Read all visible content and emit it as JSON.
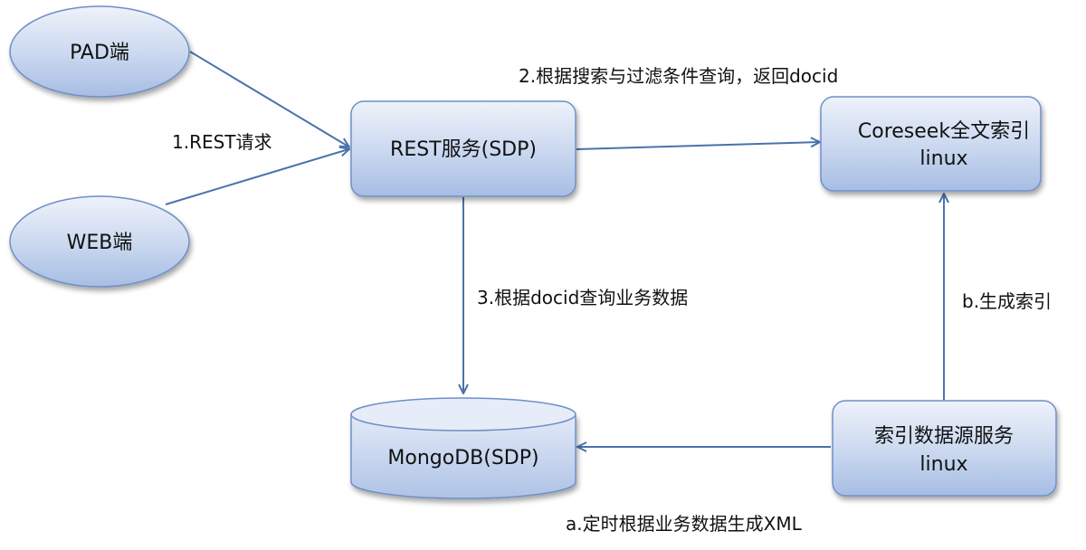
{
  "nodes": {
    "pad": {
      "label": "PAD端"
    },
    "web": {
      "label": "WEB端"
    },
    "rest": {
      "label": "REST服务(SDP)"
    },
    "coreseek": {
      "line1": "Coreseek全文索引",
      "line2": "linux"
    },
    "mongodb": {
      "label": "MongoDB(SDP)"
    },
    "index_source": {
      "line1": "索引数据源服务",
      "line2": "linux"
    }
  },
  "edges": {
    "rest_request": "1.REST请求",
    "query_docid": "2.根据搜索与过滤条件查询，返回docid",
    "query_business": "3.根据docid查询业务数据",
    "gen_xml": "a.定时根据业务数据生成XML",
    "gen_index": "b.生成索引"
  },
  "colors": {
    "node_fill_top": "#e9eef8",
    "node_fill_bottom": "#a9bfe3",
    "node_stroke": "#6f8fc7",
    "edge": "#4a72ad"
  }
}
